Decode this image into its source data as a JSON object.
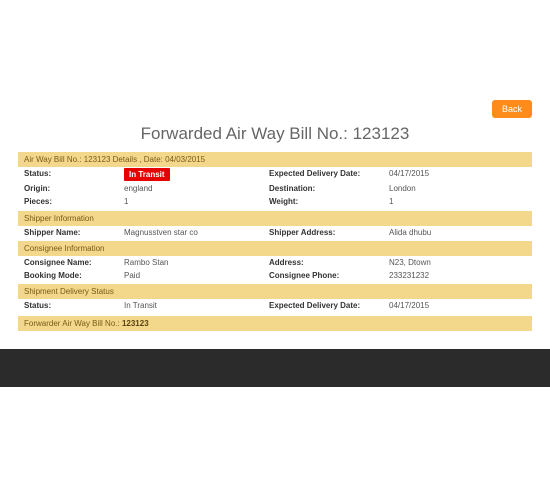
{
  "back_label": "Back",
  "title": "Forwarded Air Way Bill No.: 123123",
  "section_details_header": "Air Way Bill No.: 123123 Details , Date: 04/03/2015",
  "details": {
    "status_label": "Status:",
    "status_value": "In Transit",
    "expected_label": "Expected Delivery Date:",
    "expected_value": "04/17/2015",
    "origin_label": "Origin:",
    "origin_value": "england",
    "destination_label": "Destination:",
    "destination_value": "London",
    "pieces_label": "Pieces:",
    "pieces_value": "1",
    "weight_label": "Weight:",
    "weight_value": "1"
  },
  "shipper_header": "Shipper Information",
  "shipper": {
    "name_label": "Shipper Name:",
    "name_value": "Magnusstven star co",
    "address_label": "Shipper Address:",
    "address_value": "Alida dhubu"
  },
  "consignee_header": "Consignee Information",
  "consignee": {
    "name_label": "Consignee Name:",
    "name_value": "Rambo Stan",
    "address_label": "Address:",
    "address_value": "N23, Dtown",
    "booking_label": "Booking Mode:",
    "booking_value": "Paid",
    "phone_label": "Consignee Phone:",
    "phone_value": "233231232"
  },
  "delivery_header": "Shipment Delivery Status",
  "delivery": {
    "status_label": "Status:",
    "status_value": "In Transit",
    "expected_label": "Expected Delivery Date:",
    "expected_value": "04/17/2015"
  },
  "forwarder_prefix": "Forwarder Air Way Bill No.: ",
  "forwarder_number": "123123"
}
